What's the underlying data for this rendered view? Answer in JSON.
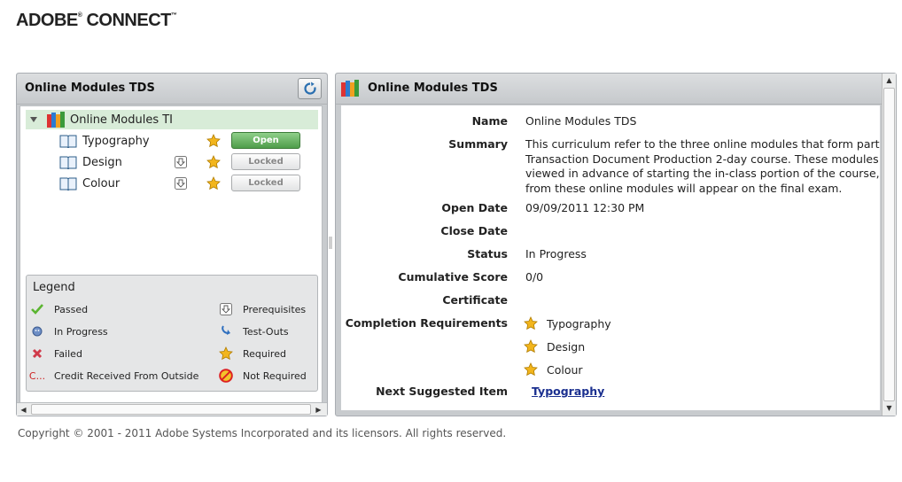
{
  "brand": {
    "name": "ADOBE",
    "name2": " CONNECT",
    "tm": "™",
    "reg": "®"
  },
  "left_panel": {
    "title": "Online Modules TDS",
    "tree": {
      "root_label": "Online Modules TI",
      "items": [
        {
          "label": "Typography",
          "action": "Open",
          "prereq": false
        },
        {
          "label": "Design",
          "action": "Locked",
          "prereq": true
        },
        {
          "label": "Colour",
          "action": "Locked",
          "prereq": true
        }
      ]
    },
    "legend": {
      "title": "Legend",
      "items": [
        {
          "label": "Passed",
          "icon": "check-icon"
        },
        {
          "label": "Prerequisites",
          "icon": "prerequisites-icon"
        },
        {
          "label": "In Progress",
          "icon": "in-progress-icon"
        },
        {
          "label": "Test-Outs",
          "icon": "test-out-icon"
        },
        {
          "label": "Failed",
          "icon": "failed-x-icon"
        },
        {
          "label": "Required",
          "icon": "star-icon"
        },
        {
          "label": "Credit Received From Outside",
          "icon": "credit-icon",
          "glyph": "C..."
        },
        {
          "label": "Not Required",
          "icon": "not-required-icon"
        }
      ]
    }
  },
  "right_panel": {
    "title": "Online Modules TDS",
    "details": {
      "name_label": "Name",
      "name_value": "Online Modules TDS",
      "summary_label": "Summary",
      "summary_lines": [
        "This curriculum refer to the three online modules that form part",
        "Transaction Document Production 2-day course. These modules",
        "viewed in advance of starting the in-class portion of the course,",
        "from these online modules will appear on the final exam."
      ],
      "open_date_label": "Open Date",
      "open_date_value": "09/09/2011 12:30 PM",
      "close_date_label": "Close Date",
      "close_date_value": "",
      "status_label": "Status",
      "status_value": "In Progress",
      "score_label": "Cumulative Score",
      "score_value": "0/0",
      "certificate_label": "Certificate",
      "certificate_value": "",
      "completion_label": "Completion Requirements",
      "completion_items": [
        "Typography",
        "Design",
        "Colour"
      ],
      "next_label": "Next Suggested Item",
      "next_value": "Typography"
    }
  },
  "footer": {
    "copyright": "Copyright © 2001 - 2011 Adobe Systems Incorporated and its licensors. All rights reserved."
  },
  "colors": {
    "open_green": "#4f9d4a",
    "tree_highlight": "#d8ecd8",
    "link": "#1a2f8f",
    "star": "#f2b51c"
  }
}
